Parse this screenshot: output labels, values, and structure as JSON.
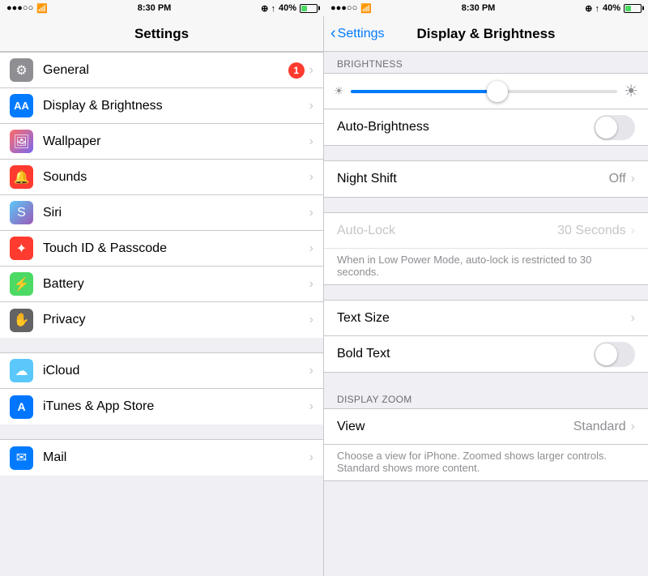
{
  "left": {
    "status": {
      "carrier": "●●●○○",
      "wifi": "WiFi",
      "time": "8:30 PM",
      "battery_pct": "40%"
    },
    "nav_title": "Settings",
    "groups": [
      {
        "items": [
          {
            "id": "general",
            "label": "General",
            "icon": "⚙",
            "icon_class": "icon-gray",
            "badge": "1",
            "chevron": true
          },
          {
            "id": "display",
            "label": "Display & Brightness",
            "icon": "AA",
            "icon_class": "icon-blue",
            "chevron": true
          },
          {
            "id": "wallpaper",
            "label": "Wallpaper",
            "icon": "❋",
            "icon_class": "icon-pink",
            "chevron": true
          },
          {
            "id": "sounds",
            "label": "Sounds",
            "icon": "🔔",
            "icon_class": "icon-red",
            "chevron": true
          },
          {
            "id": "siri",
            "label": "Siri",
            "icon": "S",
            "icon_class": "icon-dark-gray",
            "chevron": true
          },
          {
            "id": "touchid",
            "label": "Touch ID & Passcode",
            "icon": "✦",
            "icon_class": "icon-red",
            "chevron": true
          },
          {
            "id": "battery",
            "label": "Battery",
            "icon": "⚡",
            "icon_class": "icon-green",
            "chevron": true
          },
          {
            "id": "privacy",
            "label": "Privacy",
            "icon": "✋",
            "icon_class": "icon-dark-gray",
            "chevron": true
          }
        ]
      },
      {
        "items": [
          {
            "id": "icloud",
            "label": "iCloud",
            "icon": "☁",
            "icon_class": "icon-light-blue",
            "chevron": true
          },
          {
            "id": "itunes",
            "label": "iTunes & App Store",
            "icon": "A",
            "icon_class": "icon-app-store",
            "chevron": true
          }
        ]
      },
      {
        "items": [
          {
            "id": "mail",
            "label": "Mail",
            "icon": "✉",
            "icon_class": "icon-mail",
            "chevron": true
          }
        ]
      }
    ]
  },
  "right": {
    "status": {
      "carrier": "●●●○○",
      "time": "8:30 PM",
      "battery_pct": "40%"
    },
    "nav_back_label": "Settings",
    "nav_title": "Display & Brightness",
    "brightness_section_header": "BRIGHTNESS",
    "slider_pct": 55,
    "auto_brightness_label": "Auto-Brightness",
    "night_shift_label": "Night Shift",
    "night_shift_value": "Off",
    "auto_lock_section_header": "",
    "auto_lock_label": "Auto-Lock",
    "auto_lock_value": "30 Seconds",
    "auto_lock_note": "When in Low Power Mode, auto-lock is restricted to 30 seconds.",
    "text_size_label": "Text Size",
    "bold_text_label": "Bold Text",
    "display_zoom_header": "DISPLAY ZOOM",
    "view_label": "View",
    "view_value": "Standard",
    "view_note": "Choose a view for iPhone. Zoomed shows larger controls. Standard shows more content."
  }
}
